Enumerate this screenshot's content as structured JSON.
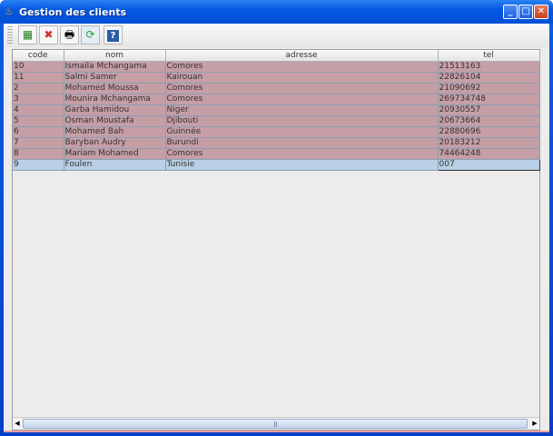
{
  "window": {
    "title": "Gestion des clients"
  },
  "toolbar": {
    "buttons": [
      {
        "icon": "color-palette-icon",
        "symbol": "▦"
      },
      {
        "icon": "delete-icon",
        "symbol": "✖"
      },
      {
        "icon": "print-icon",
        "symbol": "🖶"
      },
      {
        "icon": "refresh-icon",
        "symbol": "⟳"
      },
      {
        "icon": "help-icon",
        "symbol": "?"
      }
    ]
  },
  "table": {
    "columns": [
      "code",
      "nom",
      "adresse",
      "tel"
    ],
    "rows": [
      [
        "10",
        "Ismaila Mchangama",
        "Comores",
        "21513163"
      ],
      [
        "11",
        "Salmi Samer",
        "Kairouan",
        "22826104"
      ],
      [
        "2",
        "Mohamed Moussa",
        "Comores",
        "21090692"
      ],
      [
        "3",
        "Mounira  Mchangama",
        "Comores",
        "269734748"
      ],
      [
        "4",
        "Garba Hamidou",
        "Niger",
        "20930557"
      ],
      [
        "5",
        "Osman Moustafa",
        "Djibouti",
        "20673664"
      ],
      [
        "6",
        "Mohamed Bah",
        "Guinnée",
        "22880696"
      ],
      [
        "7",
        "Baryban Audry",
        "Burundi",
        "20183212"
      ],
      [
        "8",
        "Mariam Mohamed",
        "Comores",
        "74464248"
      ],
      [
        "9",
        "Foulen",
        "Tunisie",
        "007"
      ]
    ]
  }
}
